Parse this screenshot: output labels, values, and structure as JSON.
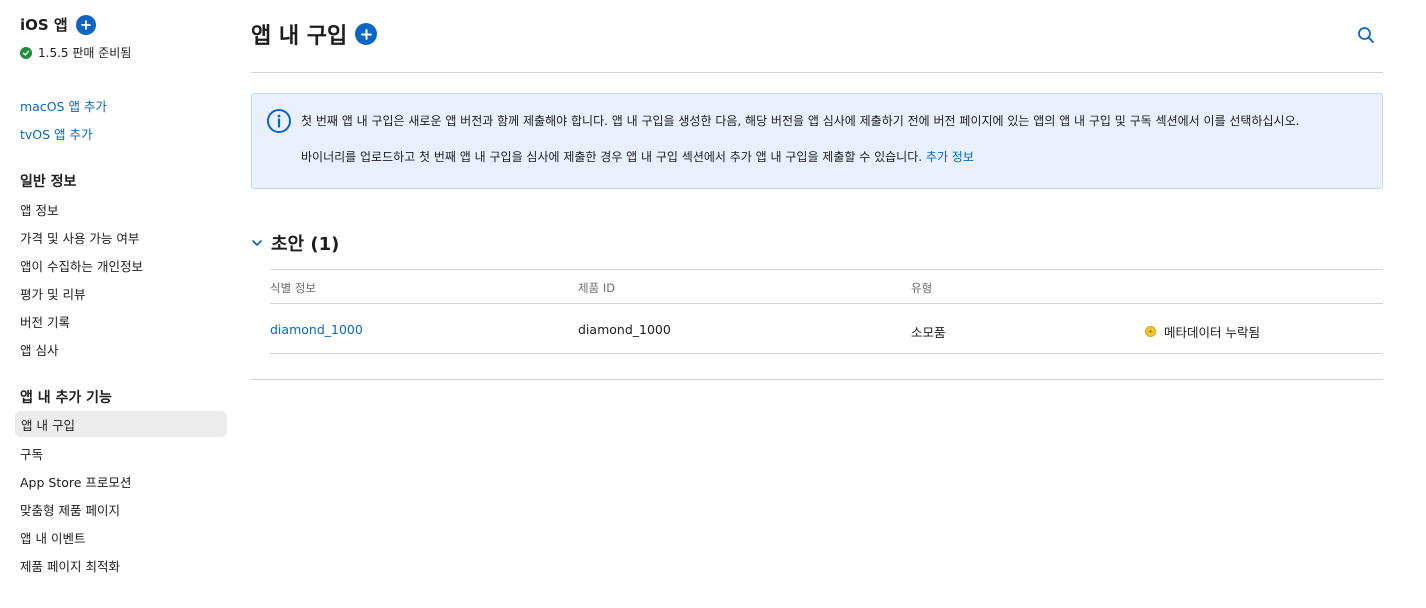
{
  "sidebar": {
    "platform_title": "iOS 앱",
    "status_text": "1.5.5 판매 준비됨",
    "add_links": [
      "macOS 앱 추가",
      "tvOS 앱 추가"
    ],
    "general_heading": "일반 정보",
    "general_items": [
      "앱 정보",
      "가격 및 사용 가능 여부",
      "앱이 수집하는 개인정보",
      "평가 및 리뷰",
      "버전 기록",
      "앱 심사"
    ],
    "features_heading": "앱 내 추가 기능",
    "feature_items": [
      "앱 내 구입",
      "구독",
      "App Store 프로모션",
      "맞춤형 제품 페이지",
      "앱 내 이벤트",
      "제품 페이지 최적화"
    ],
    "active_item": "앱 내 구입"
  },
  "main": {
    "title": "앱 내 구입",
    "info": {
      "line1": "첫 번째 앱 내 구입은 새로운 앱 버전과 함께 제출해야 합니다. 앱 내 구입을 생성한 다음, 해당 버전을 앱 심사에 제출하기 전에 버전 페이지에 있는 앱의 앱 내 구입 및 구독 섹션에서 이를 선택하십시오.",
      "line2": "바이너리를 업로드하고 첫 번째 앱 내 구입을 심사에 제출한 경우 앱 내 구입 섹션에서 추가 앱 내 구입을 제출할 수 있습니다.",
      "link": "추가 정보"
    },
    "section_title": "초안 (1)",
    "table": {
      "headers": [
        "식별 정보",
        "제품 ID",
        "유형"
      ],
      "rows": [
        {
          "reference": "diamond_1000",
          "product_id": "diamond_1000",
          "type": "소모품",
          "status": "메타데이터 누락됨"
        }
      ]
    }
  },
  "colors": {
    "accent": "#0a66c2",
    "ready_green": "#1e8e3e",
    "warning_yellow": "#f4c430",
    "info_bg": "#e8f1fb"
  },
  "icons": [
    "plus-circle-icon",
    "check-circle-icon",
    "search-icon",
    "info-icon",
    "chevron-down-icon",
    "warning-dot-icon"
  ]
}
